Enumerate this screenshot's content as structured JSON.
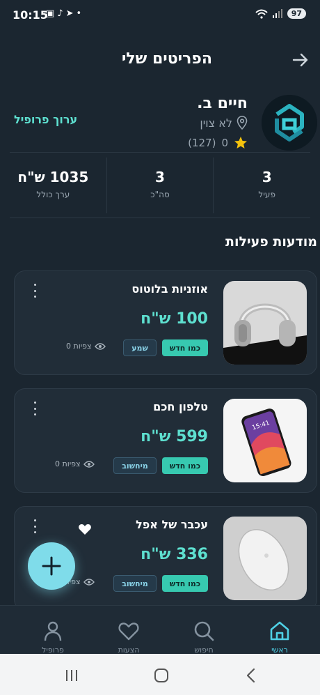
{
  "status_bar": {
    "time": "10:15",
    "icons_left": [
      "screenshot-icon",
      "tiktok-icon",
      "telegram-icon",
      "dot"
    ],
    "battery": "97"
  },
  "header": {
    "title": "הפריטים שלי"
  },
  "profile": {
    "name": "חיים ב.",
    "location": "לא צוין",
    "rating": "0",
    "reviews": "(127)",
    "edit_label": "ערוך פרופיל"
  },
  "stats": [
    {
      "value": "1035 ש\"ח",
      "label": "ערך כולל"
    },
    {
      "value": "3",
      "label": "סה\"כ"
    },
    {
      "value": "3",
      "label": "פעיל"
    }
  ],
  "section_title": "מודעות פעילות",
  "items": [
    {
      "title": "אוזניות בלוטוס",
      "price": "100 ש\"ח",
      "condition": "כמו חדש",
      "category": "שמע",
      "views": "0 צפיות",
      "image": "headphones"
    },
    {
      "title": "טלפון חכם",
      "price": "599 ש\"ח",
      "condition": "כמו חדש",
      "category": "מיחשוב",
      "views": "0 צפיות",
      "image": "smartphone"
    },
    {
      "title": "עכבר של אפל",
      "price": "336 ש\"ח",
      "condition": "כמו חדש",
      "category": "מיחשוב",
      "views": "0 צפיות",
      "image": "mouse"
    }
  ],
  "bottom_nav": [
    {
      "label": "פרופיל",
      "icon": "user-icon"
    },
    {
      "label": "הצעות",
      "icon": "heart-icon"
    },
    {
      "label": "חיפוש",
      "icon": "search-icon"
    },
    {
      "label": "ראשי",
      "icon": "home-icon",
      "active": true
    }
  ],
  "colors": {
    "background": "#1b2630",
    "card": "#212d38",
    "accent": "#5ee0d0",
    "condition_tag": "#37c9b0",
    "fab": "#7fdcea",
    "active_nav": "#4fd1e6"
  }
}
